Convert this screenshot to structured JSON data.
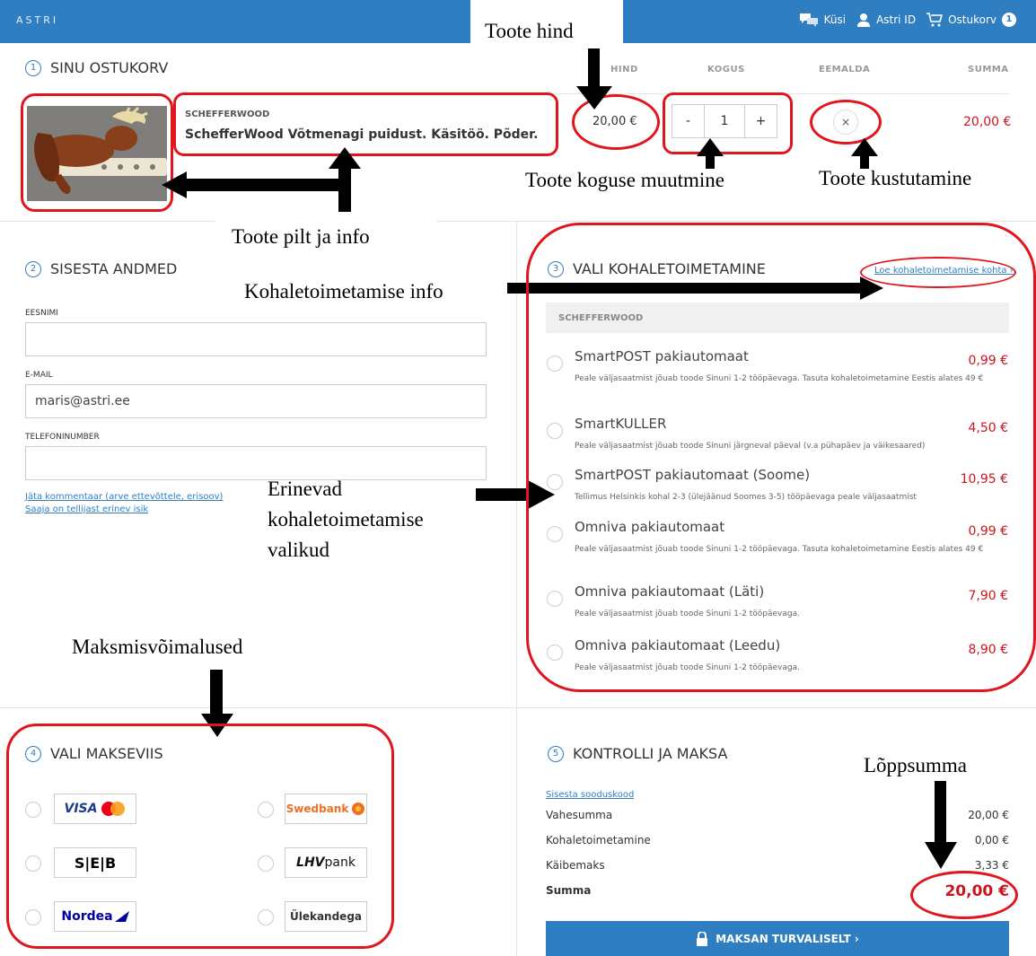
{
  "header": {
    "logo": "ASTRI",
    "ask": "Küsi",
    "astri_id": "Astri ID",
    "cart": "Ostukorv",
    "cart_count": "1"
  },
  "cart": {
    "step": "1",
    "title": "SINU OSTUKORV",
    "col_price": "HIND",
    "col_qty": "KOGUS",
    "col_remove": "EEMALDA",
    "col_sum": "SUMMA",
    "brand": "SCHEFFERWOOD",
    "product": "SchefferWood Võtmenagi puidust. Käsitöö. Põder.",
    "price": "20,00 €",
    "qty_minus": "-",
    "qty": "1",
    "qty_plus": "+",
    "remove": "×",
    "sum": "20,00 €"
  },
  "details": {
    "step": "2",
    "title": "SISESTA ANDMED",
    "first_name_label": "EESNIMI",
    "first_name_value": "",
    "email_label": "E-MAIL",
    "email_value": "maris@astri.ee",
    "phone_label": "TELEFONINUMBER",
    "phone_value": "",
    "comment_link": "Jäta kommentaar (arve ettevõttele, erisoov)",
    "recipient_link": "Saaja on tellijast erinev isik"
  },
  "delivery": {
    "step": "3",
    "title": "VALI KOHALETOIMETAMINE",
    "info_link": "Loe kohaletoimetamise kohta ›",
    "seller": "SCHEFFERWOOD",
    "options": [
      {
        "name": "SmartPOST pakiautomaat",
        "price": "0,99 €",
        "desc": "Peale väljasaatmist jõuab toode Sinuni 1-2 tööpäevaga. Tasuta kohaletoimetamine Eestis alates 49 €"
      },
      {
        "name": "SmartKULLER",
        "price": "4,50 €",
        "desc": "Peale väljasaatmist jõuab toode Sinuni järgneval päeval (v.a pühapäev ja väikesaared)"
      },
      {
        "name": "SmartPOST pakiautomaat (Soome)",
        "price": "10,95 €",
        "desc": "Tellimus Helsinkis kohal 2-3 (ülejäänud Soomes 3-5) tööpäevaga peale väljasaatmist"
      },
      {
        "name": "Omniva pakiautomaat",
        "price": "0,99 €",
        "desc": "Peale väljasaatmist jõuab toode Sinuni 1-2 tööpäevaga. Tasuta kohaletoimetamine Eestis alates 49 €"
      },
      {
        "name": "Omniva pakiautomaat (Läti)",
        "price": "7,90 €",
        "desc": "Peale väljasaatmist jõuab toode Sinuni 1-2 tööpäevaga."
      },
      {
        "name": "Omniva pakiautomaat (Leedu)",
        "price": "8,90 €",
        "desc": "Peale väljasaatmist jõuab toode Sinuni 1-2 tööpäevaga."
      }
    ]
  },
  "payment": {
    "step": "4",
    "title": "VALI MAKSEVIIS",
    "visa": "VISA",
    "swedbank": "Swedbank",
    "seb": "S|E|B",
    "lhv_a": "LHV",
    "lhv_b": "pank",
    "nordea": "Nordea",
    "transfer": "Ülekandega"
  },
  "checkout": {
    "step": "5",
    "title": "KONTROLLI JA MAKSA",
    "discount_link": "Sisesta sooduskood",
    "subtotal_label": "Vahesumma",
    "subtotal": "20,00 €",
    "shipping_label": "Kohaletoimetamine",
    "shipping": "0,00 €",
    "vat_label": "Käibemaks",
    "vat": "3,33 €",
    "total_label": "Summa",
    "total": "20,00 €",
    "pay_button": "MAKSAN TURVALISELT ›"
  },
  "annotations": {
    "price": "Toote hind",
    "qty": "Toote koguse muutmine",
    "remove": "Toote kustutamine",
    "product": "Toote pilt ja info",
    "delivery_info": "Kohaletoimetamise info",
    "delivery_options_1": "Erinevad",
    "delivery_options_2": "kohaletoimetamise",
    "delivery_options_3": "valikud",
    "payment": "Maksmisvõimalused",
    "total": "Lõppsumma"
  },
  "colors": {
    "brand_blue": "#2f7ec1",
    "price_red": "#c9161e",
    "annotation_red": "#e0161f"
  }
}
